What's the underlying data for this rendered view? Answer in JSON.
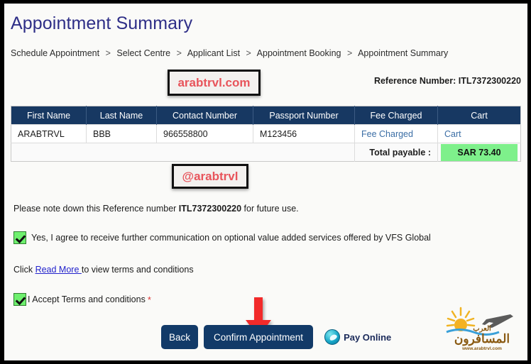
{
  "page": {
    "title": "Appointment Summary",
    "reference_number_label": "Reference Number: ITL7372300220"
  },
  "breadcrumb": {
    "separator": ">",
    "items": [
      "Schedule Appointment",
      "Select Centre",
      "Applicant List",
      "Appointment Booking",
      "Appointment Summary"
    ]
  },
  "watermarks": {
    "top": "arabtrvl.com",
    "middle": "@arabtrvl"
  },
  "table": {
    "headers": [
      "First Name",
      "Last Name",
      "Contact Number",
      "Passport Number",
      "Fee Charged",
      "Cart"
    ],
    "rows": [
      {
        "first_name": "ARABTRVL",
        "last_name": "BBB",
        "contact_number": "966558800",
        "passport_number": "M123456",
        "fee_charged": "Fee Charged",
        "cart": "Cart"
      }
    ],
    "total_label": "Total payable :",
    "total_amount": "SAR 73.40"
  },
  "notes": {
    "note_prefix": "Please note down this Reference number ",
    "note_reference": "ITL7372300220",
    "note_suffix": " for future use.",
    "optin_label": "Yes, I agree to receive further communication on optional value added services offered by VFS Global",
    "terms_prefix": "Click ",
    "read_more": "Read More ",
    "terms_suffix": "to view terms and conditions",
    "accept_label": "I Accept Terms and conditions",
    "required_marker": "*"
  },
  "buttons": {
    "back": "Back",
    "confirm": "Confirm Appointment",
    "pay_online": "Pay Online"
  },
  "brand_logo": {
    "arabic_small": "العرب",
    "arabic_main": "المسافرون",
    "url": "www.arabtrvl.com"
  },
  "colors": {
    "title": "#2e2e87",
    "table_header_bg": "#173862",
    "amount_highlight": "#7ef08b",
    "button_bg": "#123a68",
    "link": "#3b6ea5",
    "watermark_text": "#e8545b",
    "arrow": "#f22a2a"
  }
}
